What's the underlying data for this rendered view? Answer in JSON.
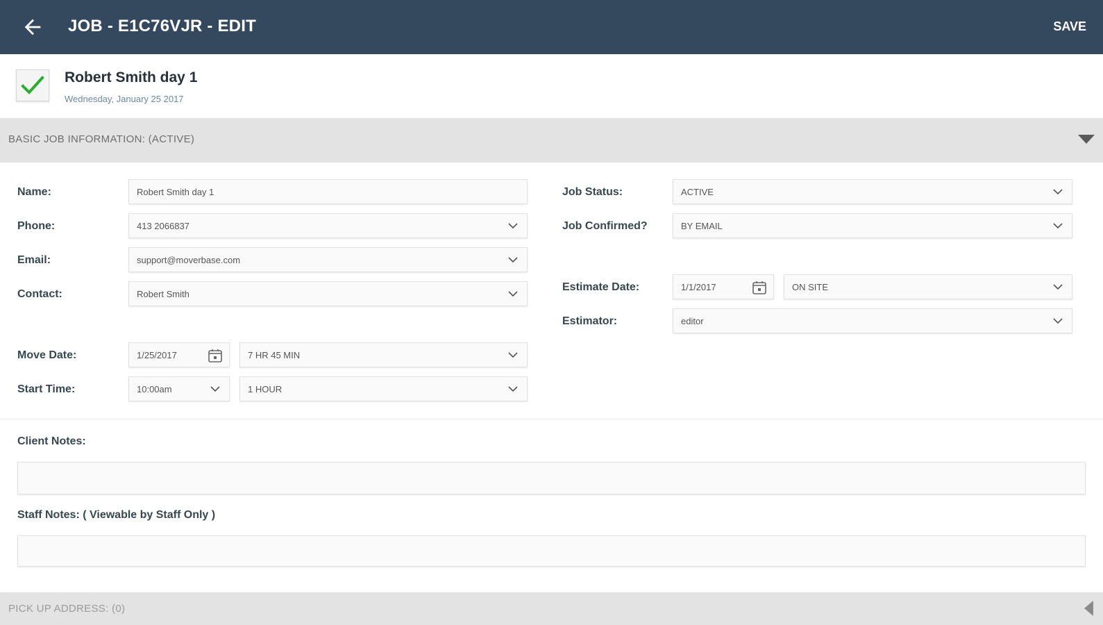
{
  "appbar": {
    "back_icon": "arrow-left-icon",
    "title": "JOB - E1C76VJR - EDIT",
    "save_label": "SAVE",
    "bg_color": "#34495e"
  },
  "job": {
    "completed_icon": "checkmark-icon",
    "name": "Robert Smith day 1",
    "date": "Wednesday, January 25 2017"
  },
  "basic_section": {
    "title": "BASIC JOB INFORMATION: (ACTIVE)",
    "toggle_icon": "caret-down-icon"
  },
  "left_fields": {
    "name_label": "Name:",
    "name_value": "Robert Smith day 1",
    "phone_label": "Phone:",
    "phone_value": "413 2066837",
    "email_label": "Email:",
    "email_value": "support@moverbase.com",
    "contact_label": "Contact:",
    "contact_value": "Robert Smith",
    "move_date_label": "Move Date:",
    "move_date_value": "1/25/2017",
    "move_duration_value": "7 HR 45 MIN",
    "start_time_label": "Start Time:",
    "start_time_value": "10:00am",
    "arrival_window_value": "1 HOUR"
  },
  "right_fields": {
    "status_label": "Job Status:",
    "status_value": "ACTIVE",
    "confirmed_label": "Job Confirmed?",
    "confirmed_value": "BY EMAIL",
    "estimate_date_label": "Estimate Date:",
    "estimate_date_value": "1/1/2017",
    "estimate_type_value": "ON SITE",
    "estimator_label": "Estimator:",
    "estimator_value": "editor"
  },
  "notes": {
    "client_label": "Client Notes:",
    "client_value": "",
    "staff_label": "Staff Notes: ( Viewable by Staff Only )",
    "staff_value": ""
  },
  "pickup_section": {
    "title": "PICK UP ADDRESS: (0)",
    "toggle_icon": "caret-left-icon"
  }
}
